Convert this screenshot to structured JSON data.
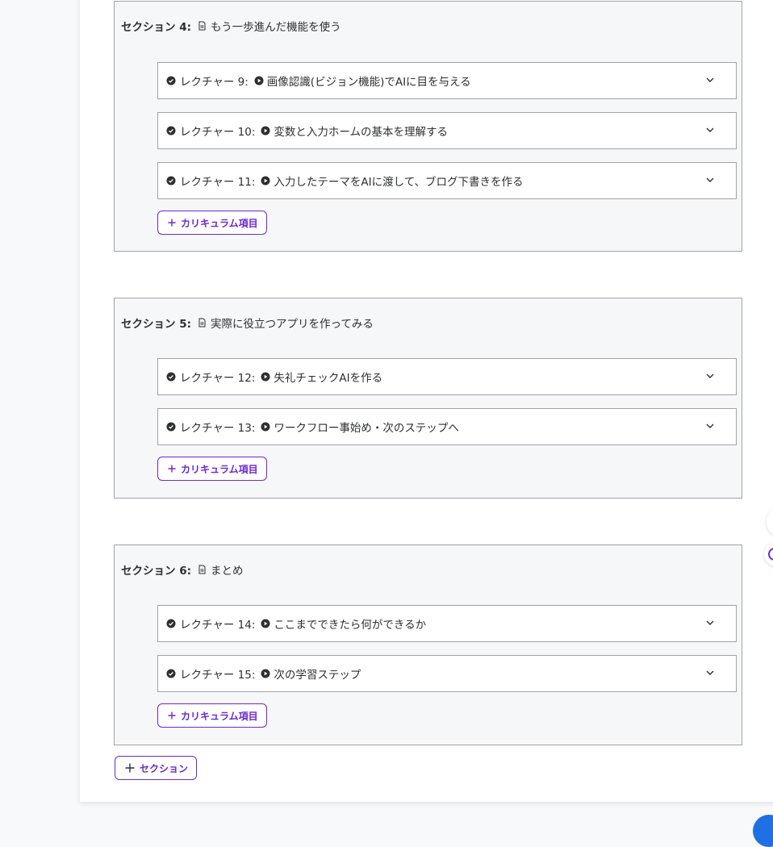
{
  "sections": [
    {
      "label": "セクション 4:",
      "title": "もう一歩進んだ機能を使う",
      "lectures": [
        {
          "label": "レクチャー 9:",
          "title": "画像認識(ビジョン機能)でAIに目を与える"
        },
        {
          "label": "レクチャー 10:",
          "title": "変数と入力ホームの基本を理解する"
        },
        {
          "label": "レクチャー 11:",
          "title": "入力したテーマをAIに渡して、ブログ下書きを作る"
        }
      ],
      "add_label": "カリキュラム項目"
    },
    {
      "label": "セクション 5:",
      "title": "実際に役立つアプリを作ってみる",
      "lectures": [
        {
          "label": "レクチャー 12:",
          "title": "失礼チェックAIを作る"
        },
        {
          "label": "レクチャー 13:",
          "title": "ワークフロー事始め・次のステップへ"
        }
      ],
      "add_label": "カリキュラム項目"
    },
    {
      "label": "セクション 6:",
      "title": "まとめ",
      "lectures": [
        {
          "label": "レクチャー 14:",
          "title": "ここまでできたら何ができるか"
        },
        {
          "label": "レクチャー 15:",
          "title": "次の学習ステップ"
        }
      ],
      "add_label": "カリキュラム項目"
    }
  ],
  "add_section_label": "セクション",
  "icons": {
    "section": "document-icon",
    "lecture_status": "check-circle-icon",
    "lecture_type": "play-circle-icon",
    "expand": "chevron-down-icon",
    "add": "plus-icon"
  },
  "colors": {
    "accent": "#6d28d2",
    "border": "#9ea4a9",
    "section_bg": "#f6f7f9",
    "text": "#2d2f31"
  }
}
